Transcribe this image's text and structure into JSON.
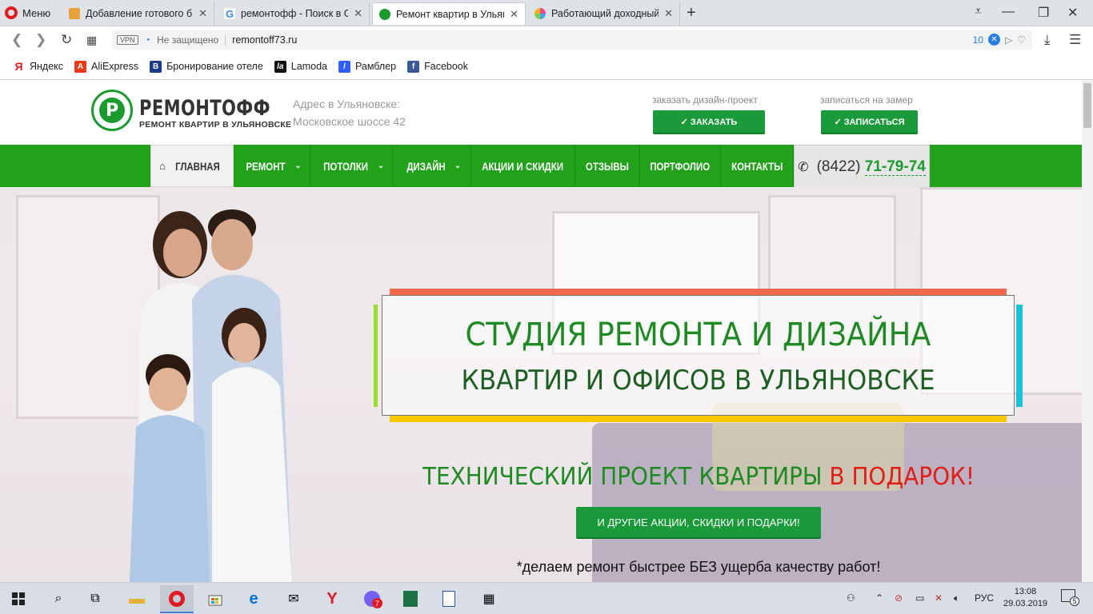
{
  "browser": {
    "menu_label": "Меню",
    "tabs": [
      {
        "title": "Добавление готового би",
        "favicon_color": "#e8a23c"
      },
      {
        "title": "ремонтофф - Поиск в Go",
        "favicon_color": "#4285f4"
      },
      {
        "title": "Ремонт квартир в Ульяно",
        "favicon_color": "#1b9a2e",
        "active": true
      },
      {
        "title": "Работающий доходный б",
        "favicon_color": "#e34b8a"
      }
    ],
    "address": {
      "vpn": "VPN",
      "security": "Не защищено",
      "url": "remontoff73.ru",
      "adblock_count": "10"
    },
    "bookmarks": [
      {
        "label": "Яндекс",
        "icon": "yandex-icon",
        "color": "#e01a22",
        "glyph": "Я"
      },
      {
        "label": "AliExpress",
        "icon": "aliexpress-icon",
        "color": "#e63c1a",
        "glyph": "A"
      },
      {
        "label": "Бронирование отелe",
        "icon": "booking-icon",
        "color": "#1a3a8a",
        "glyph": "B"
      },
      {
        "label": "Lamoda",
        "icon": "lamoda-icon",
        "color": "#111111",
        "glyph": "la"
      },
      {
        "label": "Рамблер",
        "icon": "rambler-icon",
        "color": "#315efb",
        "glyph": "/"
      },
      {
        "label": "Facebook",
        "icon": "facebook-icon",
        "color": "#3b5998",
        "glyph": "f"
      }
    ]
  },
  "site": {
    "logo_name": "РЕМОНТОФФ",
    "logo_sub": "РЕМОНТ КВАРТИР В УЛЬЯНОВСКЕ",
    "address_label": "Адрес в Ульяновске:",
    "address_value": "Московское шоссе 42",
    "cta1_caption": "заказать дизайн-проект",
    "cta1_button": "✓ ЗАКАЗАТЬ",
    "cta2_caption": "записаться на замер",
    "cta2_button": "✓ ЗАПИСАТЬСЯ",
    "nav": [
      {
        "label": "ГЛАВНАЯ"
      },
      {
        "label": "РЕМОНТ"
      },
      {
        "label": "ПОТОЛКИ"
      },
      {
        "label": "ДИЗАЙН"
      },
      {
        "label": "АКЦИИ И СКИДКИ"
      },
      {
        "label": "ОТЗЫВЫ"
      },
      {
        "label": "ПОРТФОЛИО"
      },
      {
        "label": "КОНТАКТЫ"
      }
    ],
    "phone_code": "(8422)",
    "phone_number": "71-79-74",
    "hero_line1": "СТУДИЯ РЕМОНТА И ДИЗАЙНА",
    "hero_line2": "КВАРТИР И ОФИСОВ В УЛЬЯНОВСКЕ",
    "promo_green": "ТЕХНИЧЕСКИЙ ПРОЕКТ КВАРТИРЫ ",
    "promo_red": "В ПОДАРОК!",
    "promo_button": "И ДРУГИЕ АКЦИИ, СКИДКИ И ПОДАРКИ!",
    "note": "*делаем ремонт быстрее БЕЗ ущерба качеству работ!",
    "colors": {
      "brand_green": "#21a21a",
      "accent_red": "#e11d16"
    }
  },
  "taskbar": {
    "lang": "РУС",
    "time": "13:08",
    "date": "29.03.2019",
    "notifications": "5",
    "viber_badge": "7"
  }
}
